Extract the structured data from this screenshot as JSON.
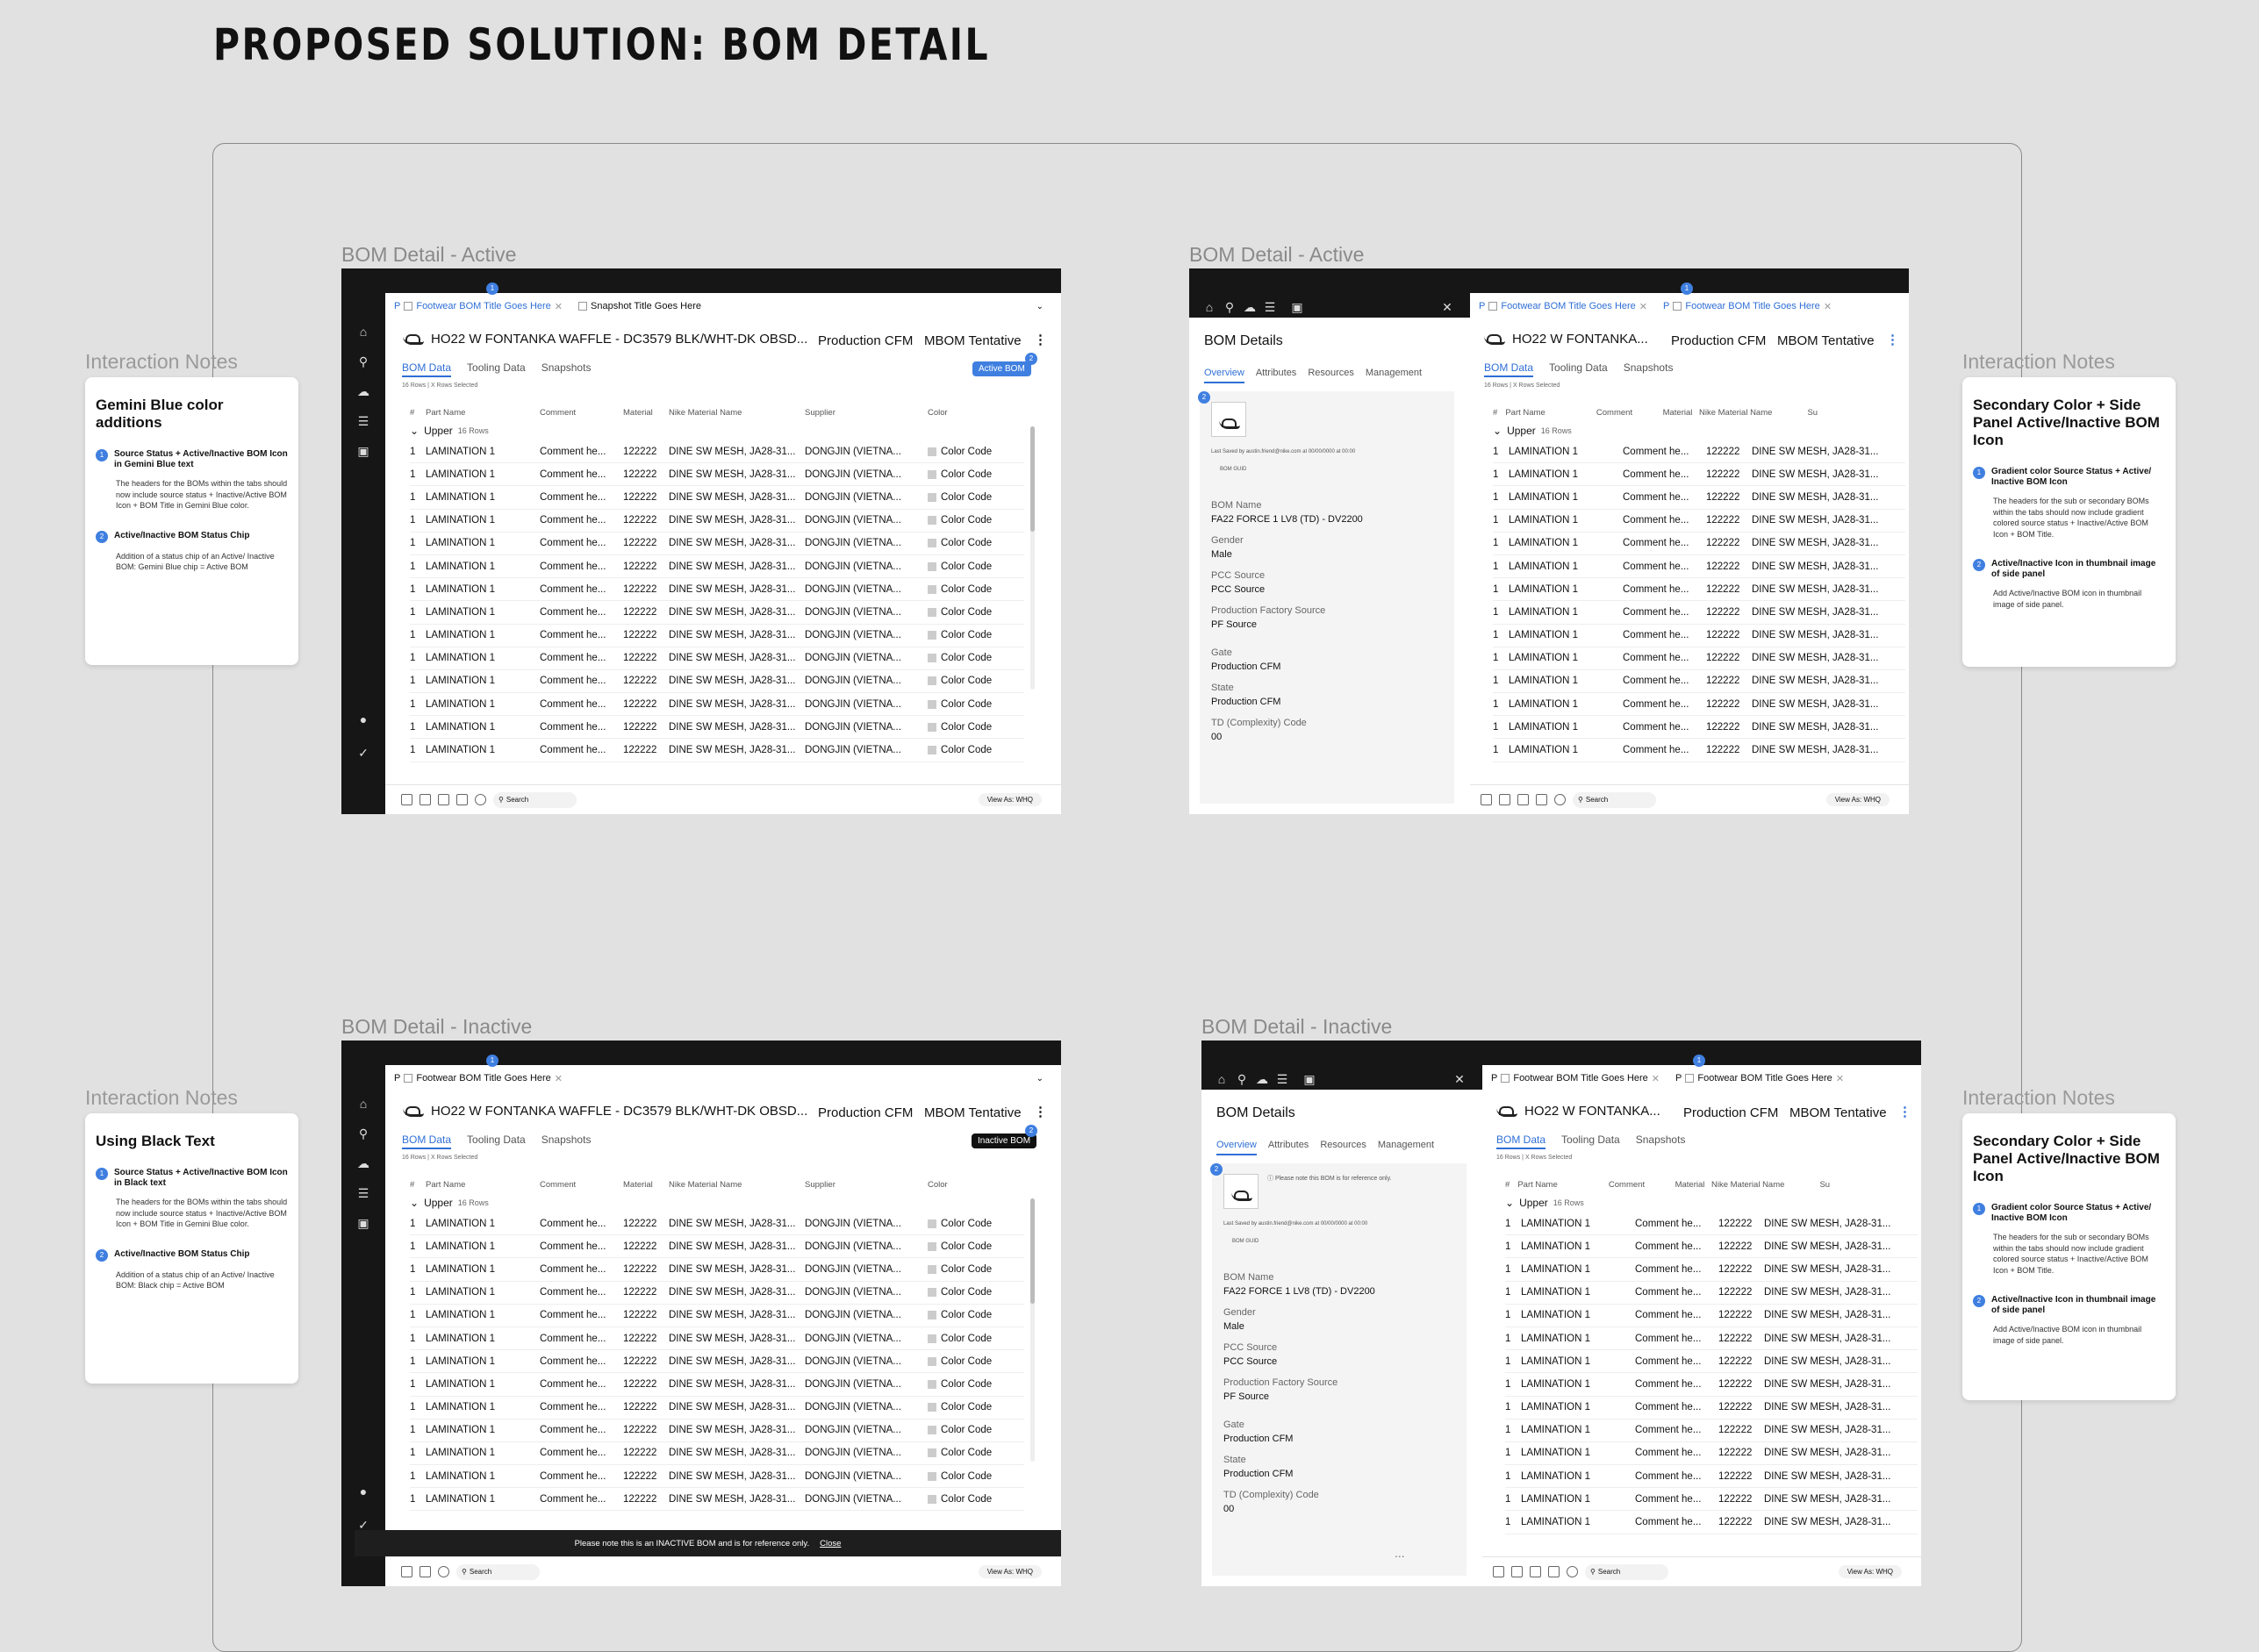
{
  "page_title": "PROPOSED SOLUTION: BOM DETAIL",
  "frame_labels": [
    "BOM Detail - Active",
    "BOM Detail - Active",
    "BOM Detail - Inactive",
    "BOM Detail - Inactive"
  ],
  "notes_heading": "Interaction Notes",
  "notes": [
    {
      "title": "Gemini Blue color additions",
      "items": [
        {
          "num": "1",
          "head": "Source Status + Active/Inactive BOM Icon in Gemini Blue text",
          "body": "The headers for the BOMs within the tabs should now include source status + Inactive/Active BOM Icon + BOM Title in Gemini Blue color."
        },
        {
          "num": "2",
          "head": "Active/Inactive BOM Status Chip",
          "body": "Addition of a status chip of an Active/ Inactive BOM: Gemini Blue chip = Active BOM"
        }
      ]
    },
    {
      "title": "Secondary Color + Side Panel Active/Inactive BOM Icon",
      "items": [
        {
          "num": "1",
          "head": "Gradient color Source Status + Active/ Inactive BOM Icon",
          "body": "The headers for the sub or secondary BOMs within the tabs should now include gradient colored source status + Inactive/Active BOM Icon + BOM Title."
        },
        {
          "num": "2",
          "head": "Active/Inactive Icon in thumbnail image of side panel",
          "body": "Add Active/Inactive BOM icon in thumbnail image of side panel."
        }
      ]
    },
    {
      "title": "Using Black Text",
      "items": [
        {
          "num": "1",
          "head": "Source Status + Active/Inactive BOM Icon in Black text",
          "body": "The headers for the BOMs within the tabs should now include source status + Inactive/Active BOM Icon + BOM Title in Gemini Blue color."
        },
        {
          "num": "2",
          "head": "Active/Inactive BOM Status Chip",
          "body": "Addition of a status chip of an Active/ Inactive BOM: Black chip = Active BOM"
        }
      ]
    },
    {
      "title": "Secondary Color + Side Panel Active/Inactive BOM Icon",
      "items": [
        {
          "num": "1",
          "head": "Gradient color Source Status + Active/ Inactive BOM Icon",
          "body": "The headers for the sub or secondary BOMs within the tabs should now include gradient colored source status + Inactive/Active BOM Icon + BOM Title."
        },
        {
          "num": "2",
          "head": "Active/Inactive Icon in thumbnail image of side panel",
          "body": "Add Active/Inactive BOM icon in thumbnail image of side panel."
        }
      ]
    }
  ],
  "bom": {
    "tab_title": "Footwear BOM Title Goes Here",
    "snapshot_tab": "Snapshot Title Goes Here",
    "source_prefix": "P",
    "name_full": "HO22 W FONTANKA WAFFLE - DC3579 BLK/WHT-DK OBSD...",
    "name_short": "HO22 W FONTANKA...",
    "production": "Production CFM",
    "mbom": "MBOM Tentative",
    "subtabs": [
      "BOM Data",
      "Tooling Data",
      "Snapshots"
    ],
    "rows_selected": "16 Rows | X Rows Selected",
    "chip_active": "Active BOM",
    "chip_inactive": "Inactive BOM",
    "columns": [
      "#",
      "Part Name",
      "Comment",
      "Material",
      "Nike Material Name",
      "Supplier",
      "Color",
      "Su"
    ],
    "group": "Upper",
    "group_count": "16 Rows",
    "row": {
      "num": "1",
      "part": "LAMINATION 1",
      "comment": "Comment he...",
      "material": "122222",
      "nike_name": "DINE SW MESH, JA28-31...",
      "supplier": "DONGJIN (VIETNA...",
      "color": "Color Code"
    },
    "search": "Search",
    "view_as": "View As: WHQ",
    "badge_num": "1",
    "badge_num2": "2",
    "more": "...",
    "colors": {
      "accent": "#2f6fd6",
      "chip_active": "#3f7fe0",
      "chip_inactive": "#111111",
      "dark": "#161616"
    }
  },
  "panel": {
    "title": "BOM Details",
    "tabs": [
      "Overview",
      "Attributes",
      "Resources",
      "Management"
    ],
    "reference_note": "Please note this BOM is for reference only.",
    "last_saved": "Last Saved by austin.friend@nike.com at 00/00/0000 at 00:00",
    "bom_guid": "BOM GUID",
    "fields": [
      {
        "label": "BOM Name",
        "value": "FA22 FORCE 1 LV8 (TD) - DV2200"
      },
      {
        "label": "Gender",
        "value": "Male"
      },
      {
        "label": "PCC Source",
        "value": "PCC Source"
      },
      {
        "label": "Production Factory Source",
        "value": "PF Source"
      },
      {
        "label": "Gate",
        "value": "Production CFM"
      },
      {
        "label": "State",
        "value": "Production CFM"
      },
      {
        "label": "TD (Complexity) Code",
        "value": "00"
      }
    ]
  },
  "inactive_banner": {
    "text": "Please note this is an INACTIVE BOM and is for reference only.",
    "close": "Close"
  }
}
